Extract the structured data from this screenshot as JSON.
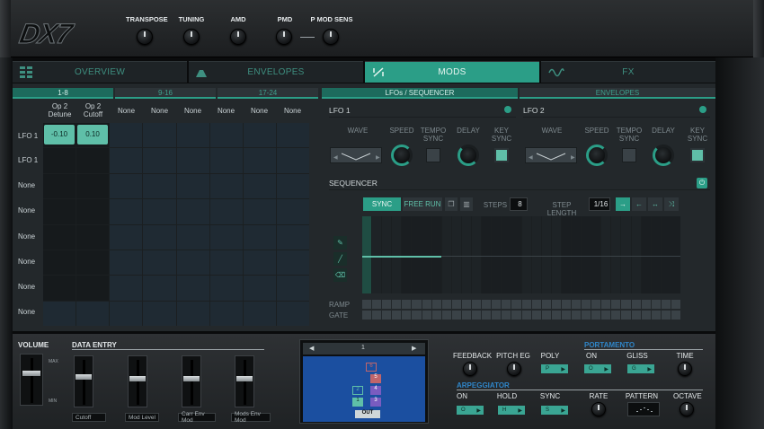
{
  "header": {
    "logo": "DX7",
    "knobs": [
      {
        "label": "TRANSPOSE"
      },
      {
        "label": "TUNING"
      },
      {
        "label": "AMD"
      },
      {
        "label": "PMD"
      },
      {
        "label": "P MOD SENS"
      }
    ]
  },
  "tabs": [
    {
      "label": "OVERVIEW",
      "icon": "grid-icon"
    },
    {
      "label": "ENVELOPES",
      "icon": "envelope-icon"
    },
    {
      "label": "MODS",
      "icon": "mods-icon",
      "active": true
    },
    {
      "label": "FX",
      "icon": "sine-wave-icon"
    }
  ],
  "matrix": {
    "pages": [
      "1-8",
      "9-16",
      "17-24"
    ],
    "columns": [
      "Op 2\nDetune",
      "Op 2\nCutoff",
      "None",
      "None",
      "None",
      "None",
      "None",
      "None"
    ],
    "rows": [
      "LFO 1",
      "LFO 1",
      "None",
      "None",
      "None",
      "None",
      "None",
      "None"
    ],
    "values": [
      [
        "-0.10",
        "0.10"
      ]
    ]
  },
  "right_tabs": [
    "LFOs / SEQUENCER",
    "ENVELOPES"
  ],
  "lfo1": {
    "title": "LFO 1",
    "labels": {
      "wave": "WAVE",
      "speed": "SPEED",
      "tempo_sync": "TEMPO\nSYNC",
      "delay": "DELAY",
      "key_sync": "KEY\nSYNC"
    }
  },
  "lfo2": {
    "title": "LFO 2",
    "labels": {
      "wave": "WAVE",
      "speed": "SPEED",
      "tempo_sync": "TEMPO\nSYNC",
      "delay": "DELAY",
      "key_sync": "KEY\nSYNC"
    }
  },
  "sequencer": {
    "title": "SEQUENCER",
    "sync_label": "SYNC",
    "free_run_label": "FREE RUN",
    "steps_label": "STEPS",
    "steps_value": "8",
    "step_length_label": "STEP LENGTH",
    "step_length_value": "1/16",
    "ramp_label": "RAMP",
    "gate_label": "GATE"
  },
  "bottom": {
    "volume_label": "VOLUME",
    "data_entry_label": "DATA ENTRY",
    "max_label": "MAX",
    "min_label": "MIN",
    "faders": [
      "Cutoff",
      "Mod Level",
      "Carr Env Mod",
      "Mods Env Mod"
    ],
    "algo": {
      "prev": "◀",
      "next": "▶",
      "value": "1",
      "out_label": "OUT",
      "ops": [
        "6",
        "5",
        "4",
        "3",
        "2",
        "1"
      ]
    },
    "labels": {
      "feedback": "FEEDBACK",
      "pitch_eg": "PITCH EG",
      "poly": "POLY",
      "portamento": "PORTAMENTO",
      "on": "ON",
      "gliss": "GLISS",
      "time": "TIME",
      "arpeggiator": "ARPEGGIATOR",
      "arp_on": "ON",
      "hold": "HOLD",
      "sync": "SYNC",
      "rate": "RATE",
      "pattern": "PATTERN",
      "octave": "OCTAVE"
    }
  },
  "colors": {
    "accent": "#2b9e87",
    "accent_light": "#5fbfa8",
    "panel": "#23282b",
    "algo_blue": "#2b5da8",
    "algo_purple": "#7a5cc0",
    "algo_red": "#c0656b"
  }
}
